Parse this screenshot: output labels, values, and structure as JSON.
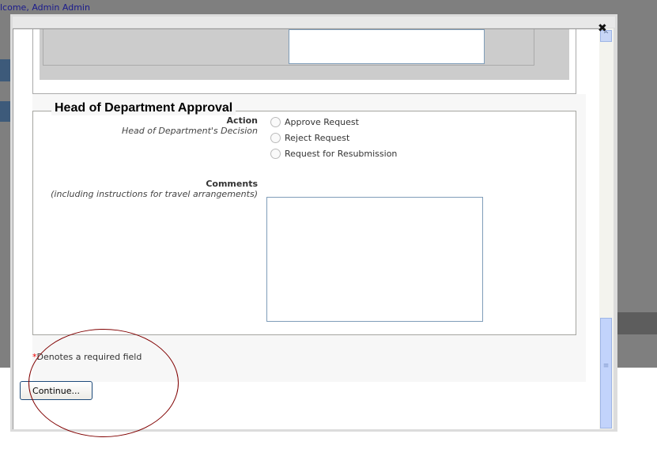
{
  "header": {
    "welcome_prefix": "lcome,",
    "user_name": "Admin Admin"
  },
  "modal": {
    "close_icon": "close-icon"
  },
  "section": {
    "title": "Head of Department Approval",
    "action_label": "Action",
    "action_hint": "Head of Department's Decision",
    "options": [
      {
        "label": "Approve Request"
      },
      {
        "label": "Reject Request"
      },
      {
        "label": "Request for Resubmission"
      }
    ],
    "comments_label": "Comments",
    "comments_hint": "(including instructions for travel arrangements)",
    "comments_value": ""
  },
  "required_note": {
    "star": "*",
    "text": "Denotes a required field"
  },
  "continue_label": "Continue..."
}
